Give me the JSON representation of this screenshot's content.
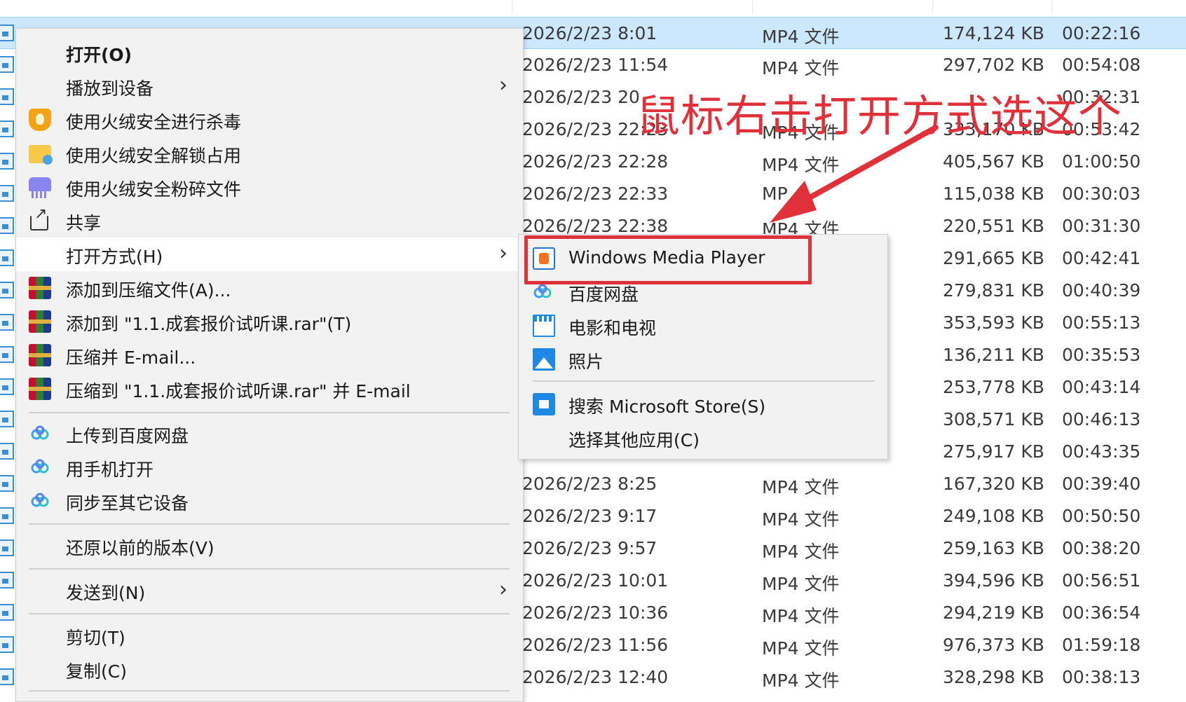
{
  "file_list": {
    "rows": [
      {
        "date": "2026/2/23 8:01",
        "type": "MP4 文件",
        "size": "174,124 KB",
        "duration": "00:22:16",
        "selected": true
      },
      {
        "date": "2026/2/23 11:54",
        "type": "MP4 文件",
        "size": "297,702 KB",
        "duration": "00:54:08"
      },
      {
        "date": "2026/2/23 20",
        "type": "",
        "size": "",
        "duration": "00:32:31"
      },
      {
        "date": "2026/2/23 22:23",
        "type": "MP4 文件",
        "size": "333,170 KB",
        "duration": "00:53:42"
      },
      {
        "date": "2026/2/23 22:28",
        "type": "MP4 文件",
        "size": "405,567 KB",
        "duration": "01:00:50"
      },
      {
        "date": "2026/2/23 22:33",
        "type": "MP",
        "size": "115,038 KB",
        "duration": "00:30:03"
      },
      {
        "date": "2026/2/23 22:38",
        "type": "MP4 文件",
        "size": "220,551 KB",
        "duration": "00:31:30"
      },
      {
        "date": "",
        "type": "",
        "size": "291,665 KB",
        "duration": "00:42:41"
      },
      {
        "date": "",
        "type": "",
        "size": "279,831 KB",
        "duration": "00:40:39"
      },
      {
        "date": "",
        "type": "",
        "size": "353,593 KB",
        "duration": "00:55:13"
      },
      {
        "date": "",
        "type": "",
        "size": "136,211 KB",
        "duration": "00:35:53"
      },
      {
        "date": "",
        "type": "",
        "size": "253,778 KB",
        "duration": "00:43:14"
      },
      {
        "date": "",
        "type": "",
        "size": "308,571 KB",
        "duration": "00:46:13"
      },
      {
        "date": "",
        "type": "",
        "size": "275,917 KB",
        "duration": "00:43:35"
      },
      {
        "date": "2026/2/23 8:25",
        "type": "MP4 文件",
        "size": "167,320 KB",
        "duration": "00:39:40"
      },
      {
        "date": "2026/2/23 9:17",
        "type": "MP4 文件",
        "size": "249,108 KB",
        "duration": "00:50:50"
      },
      {
        "date": "2026/2/23 9:57",
        "type": "MP4 文件",
        "size": "259,163 KB",
        "duration": "00:38:20"
      },
      {
        "date": "2026/2/23 10:01",
        "type": "MP4 文件",
        "size": "394,596 KB",
        "duration": "00:56:51"
      },
      {
        "date": "2026/2/23 10:36",
        "type": "MP4 文件",
        "size": "294,219 KB",
        "duration": "00:36:54"
      },
      {
        "date": "2026/2/23 11:56",
        "type": "MP4 文件",
        "size": "976,373 KB",
        "duration": "01:59:18"
      },
      {
        "date": "2026/2/23 12:40",
        "type": "MP4 文件",
        "size": "328,298 KB",
        "duration": "00:38:13"
      }
    ]
  },
  "context_menu": {
    "items": [
      {
        "label": "打开(O)",
        "icon": "",
        "bold": true
      },
      {
        "label": "播放到设备",
        "icon": "",
        "submenu": true
      },
      {
        "label": "使用火绒安全进行杀毒",
        "icon": "shield-icon"
      },
      {
        "label": "使用火绒安全解锁占用",
        "icon": "folder-unlock-icon"
      },
      {
        "label": "使用火绒安全粉碎文件",
        "icon": "shredder-icon"
      },
      {
        "label": "共享",
        "icon": "share-icon"
      },
      {
        "label": "打开方式(H)",
        "icon": "",
        "submenu": true,
        "active": true
      },
      {
        "label": "添加到压缩文件(A)...",
        "icon": "winrar-icon"
      },
      {
        "label": "添加到 \"1.1.成套报价试听课.rar\"(T)",
        "icon": "winrar-icon"
      },
      {
        "label": "压缩并 E-mail...",
        "icon": "winrar-icon"
      },
      {
        "label": "压缩到 \"1.1.成套报价试听课.rar\" 并 E-mail",
        "icon": "winrar-icon"
      },
      {
        "label": "上传到百度网盘",
        "icon": "baidu-netdisk-icon"
      },
      {
        "label": "用手机打开",
        "icon": "baidu-netdisk-icon"
      },
      {
        "label": "同步至其它设备",
        "icon": "baidu-netdisk-icon"
      },
      {
        "label": "还原以前的版本(V)",
        "icon": ""
      },
      {
        "label": "发送到(N)",
        "icon": "",
        "submenu": true
      },
      {
        "label": "剪切(T)",
        "icon": ""
      },
      {
        "label": "复制(C)",
        "icon": ""
      }
    ]
  },
  "open_with_submenu": {
    "items": [
      {
        "label": "Windows Media Player",
        "icon": "windows-media-player-icon"
      },
      {
        "label": "百度网盘",
        "icon": "baidu-netdisk-icon"
      },
      {
        "label": "电影和电视",
        "icon": "movies-tv-icon"
      },
      {
        "label": "照片",
        "icon": "photos-icon"
      },
      {
        "label": "搜索 Microsoft Store(S)",
        "icon": "microsoft-store-icon"
      },
      {
        "label": "选择其他应用(C)",
        "icon": ""
      }
    ]
  },
  "annotation": {
    "text": "鼠标右击打开方式选这个",
    "color": "#e0313b"
  },
  "colors": {
    "selection": "#cce8ff",
    "menu_bg": "#f2f2f2",
    "menu_hover": "#ffffff"
  }
}
